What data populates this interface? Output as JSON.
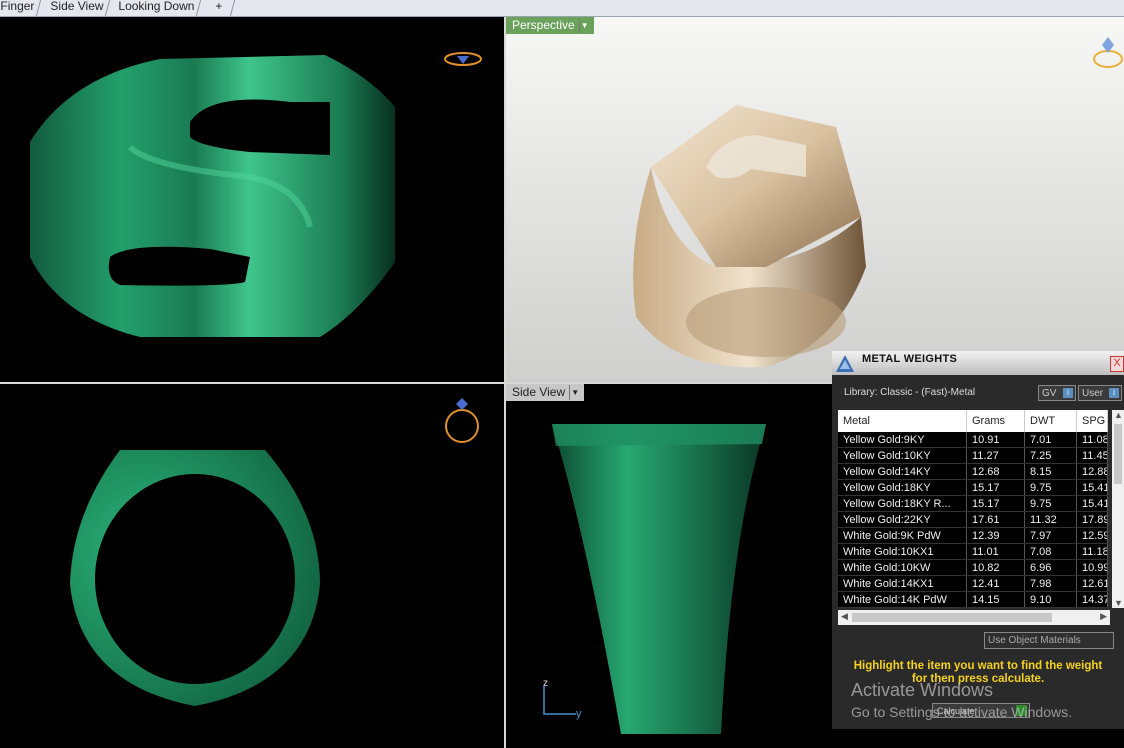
{
  "tabs": [
    "Finger",
    "Side View",
    "Looking Down",
    "+"
  ],
  "viewports": {
    "perspective_label": "Perspective",
    "side_label": "Side View",
    "axis_z": "z",
    "axis_y": "y"
  },
  "colors": {
    "ring_green": "#1f8e62",
    "ring_gold": "#e6d3b6",
    "label_green": "#6aa25c",
    "hint_yellow": "#f5d21e"
  },
  "metal_weights": {
    "title": "METAL WEIGHTS",
    "close": "X",
    "library": "Library: Classic - (Fast)-Metal",
    "gv_label": "GV",
    "user_label": "User",
    "columns": [
      "Metal",
      "Grams",
      "DWT",
      "SPG"
    ],
    "rows": [
      {
        "metal": "Yellow Gold:9KY",
        "grams": "10.91",
        "dwt": "7.01",
        "spg": "11.08"
      },
      {
        "metal": "Yellow Gold:10KY",
        "grams": "11.27",
        "dwt": "7.25",
        "spg": "11.45"
      },
      {
        "metal": "Yellow Gold:14KY",
        "grams": "12.68",
        "dwt": "8.15",
        "spg": "12.88"
      },
      {
        "metal": "Yellow Gold:18KY",
        "grams": "15.17",
        "dwt": "9.75",
        "spg": "15.41"
      },
      {
        "metal": "Yellow Gold:18KY R...",
        "grams": "15.17",
        "dwt": "9.75",
        "spg": "15.41"
      },
      {
        "metal": "Yellow Gold:22KY",
        "grams": "17.61",
        "dwt": "11.32",
        "spg": "17.89"
      },
      {
        "metal": "White Gold:9K PdW",
        "grams": "12.39",
        "dwt": "7.97",
        "spg": "12.59"
      },
      {
        "metal": "White Gold:10KX1",
        "grams": "11.01",
        "dwt": "7.08",
        "spg": "11.18"
      },
      {
        "metal": "White Gold:10KW",
        "grams": "10.82",
        "dwt": "6.96",
        "spg": "10.99"
      },
      {
        "metal": "White Gold:14KX1",
        "grams": "12.41",
        "dwt": "7.98",
        "spg": "12.61"
      },
      {
        "metal": "White Gold:14K PdW",
        "grams": "14.15",
        "dwt": "9.10",
        "spg": "14.37"
      }
    ],
    "use_object_materials": "Use Object Materials",
    "hint_line1": "Highlight the item you want to find the weight",
    "hint_line2": "for then press calculate.",
    "calculate": "Calculate"
  },
  "watermark": {
    "line1": "Activate Windows",
    "line2": "Go to Settings to activate Windows."
  }
}
